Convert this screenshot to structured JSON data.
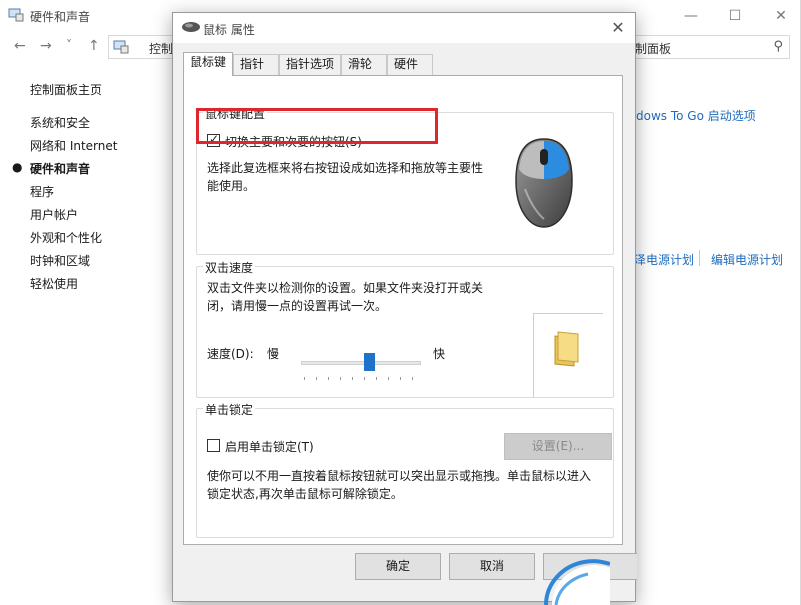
{
  "control_panel": {
    "title": "硬件和声音",
    "address_text": "控制",
    "search_placeholder": "制面板",
    "window_controls": [
      "—",
      "☐",
      "✕"
    ],
    "nav_arrows": [
      "←",
      "→",
      "˅",
      "↑"
    ],
    "sidebar": {
      "home": "控制面板主页",
      "items": [
        {
          "label": "系统和安全",
          "active": false
        },
        {
          "label": "网络和 Internet",
          "active": false
        },
        {
          "label": "硬件和声音",
          "active": true
        },
        {
          "label": "程序",
          "active": false
        },
        {
          "label": "用户帐户",
          "active": false
        },
        {
          "label": "外观和个性化",
          "active": false
        },
        {
          "label": "时钟和区域",
          "active": false
        },
        {
          "label": "轻松使用",
          "active": false
        }
      ]
    },
    "links": {
      "windows_to_go": "dows To Go 启动选项",
      "power_plan_partial": "泽电源计划",
      "edit_power_plan": "编辑电源计划"
    }
  },
  "dialog": {
    "title": "鼠标 属性",
    "close_glyph": "✕",
    "tabs": [
      "鼠标键",
      "指针",
      "指针选项",
      "滑轮",
      "硬件"
    ],
    "active_tab": 0,
    "button_config": {
      "legend": "鼠标键配置",
      "switch_checkbox_label": "切换主要和次要的按钮(S)",
      "switch_checked": true,
      "description": "选择此复选框来将右按钮设成如选择和拖放等主要性能使用。"
    },
    "double_click": {
      "legend": "双击速度",
      "description": "双击文件夹以检测你的设置。如果文件夹没打开或关闭，请用慢一点的设置再试一次。",
      "speed_label": "速度(D):",
      "slow_label": "慢",
      "fast_label": "快",
      "speed_fraction": 0.55
    },
    "click_lock": {
      "legend": "单击锁定",
      "checkbox_label": "启用单击锁定(T)",
      "checked": false,
      "settings_button": "设置(E)...",
      "description": "使你可以不用一直按着鼠标按钮就可以突出显示或拖拽。单击鼠标以进入锁定状态,再次单击鼠标可解除锁定。"
    },
    "buttons": {
      "ok": "确定",
      "cancel": "取消"
    }
  },
  "colors": {
    "accent": "#1e72c9",
    "highlight_border": "#e0262d",
    "link": "#1e6cbf"
  }
}
